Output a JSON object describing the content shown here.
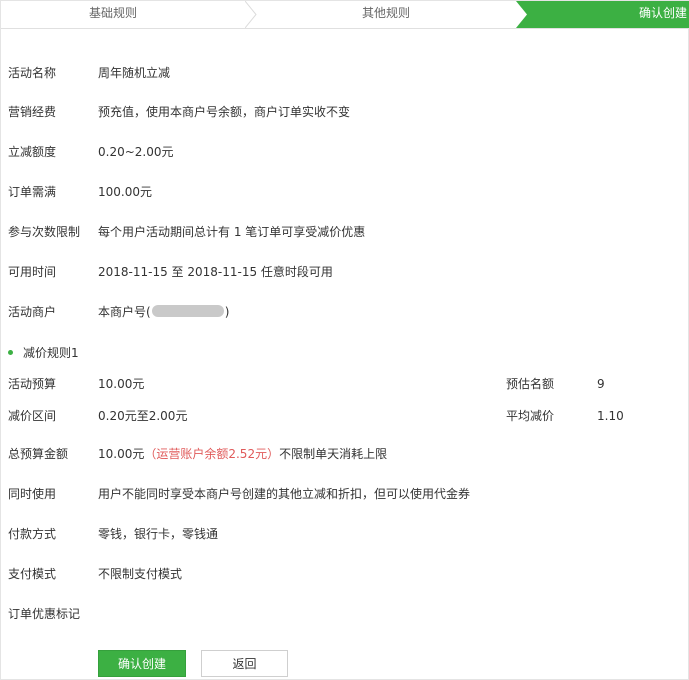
{
  "steps": {
    "step1": "基础规则",
    "step2": "其他规则",
    "step3": "确认创建"
  },
  "details": {
    "name": {
      "label": "活动名称",
      "value": "周年随机立减"
    },
    "budget_source": {
      "label": "营销经费",
      "value": "预充值，使用本商户号余额，商户订单实收不变"
    },
    "reduction": {
      "label": "立减额度",
      "value": "0.20~2.00元"
    },
    "min_order": {
      "label": "订单需满",
      "value": "100.00元"
    },
    "limit": {
      "label": "参与次数限制",
      "value": "每个用户活动期间总计有 1 笔订单可享受减价优惠"
    },
    "time": {
      "label": "可用时间",
      "value": "2018-11-15 至 2018-11-15 任意时段可用"
    },
    "merchant": {
      "label": "活动商户",
      "value_prefix": "本商户号(",
      "value_suffix": ")"
    }
  },
  "rule1": {
    "title": "减价规则1",
    "budget": {
      "label": "活动预算",
      "value": "10.00元"
    },
    "est_quota": {
      "label": "预估名额",
      "value": "9"
    },
    "range": {
      "label": "减价区间",
      "value": "0.20元至2.00元"
    },
    "avg": {
      "label": "平均减价",
      "value": "1.10"
    }
  },
  "total": {
    "label": "总预算金额",
    "value": "10.00元",
    "warning": "（运营账户余额2.52元）",
    "suffix": "不限制单天消耗上限"
  },
  "combine": {
    "label": "同时使用",
    "value": "用户不能同时享受本商户号创建的其他立减和折扣，但可以使用代金券"
  },
  "payment": {
    "label": "付款方式",
    "value": "零钱，银行卡，零钱通"
  },
  "pay_mode": {
    "label": "支付模式",
    "value": "不限制支付模式"
  },
  "order_mark": {
    "label": "订单优惠标记"
  },
  "buttons": {
    "confirm": "确认创建",
    "back": "返回"
  },
  "colors": {
    "accent": "#3cb043",
    "warning": "#e05a5a"
  }
}
